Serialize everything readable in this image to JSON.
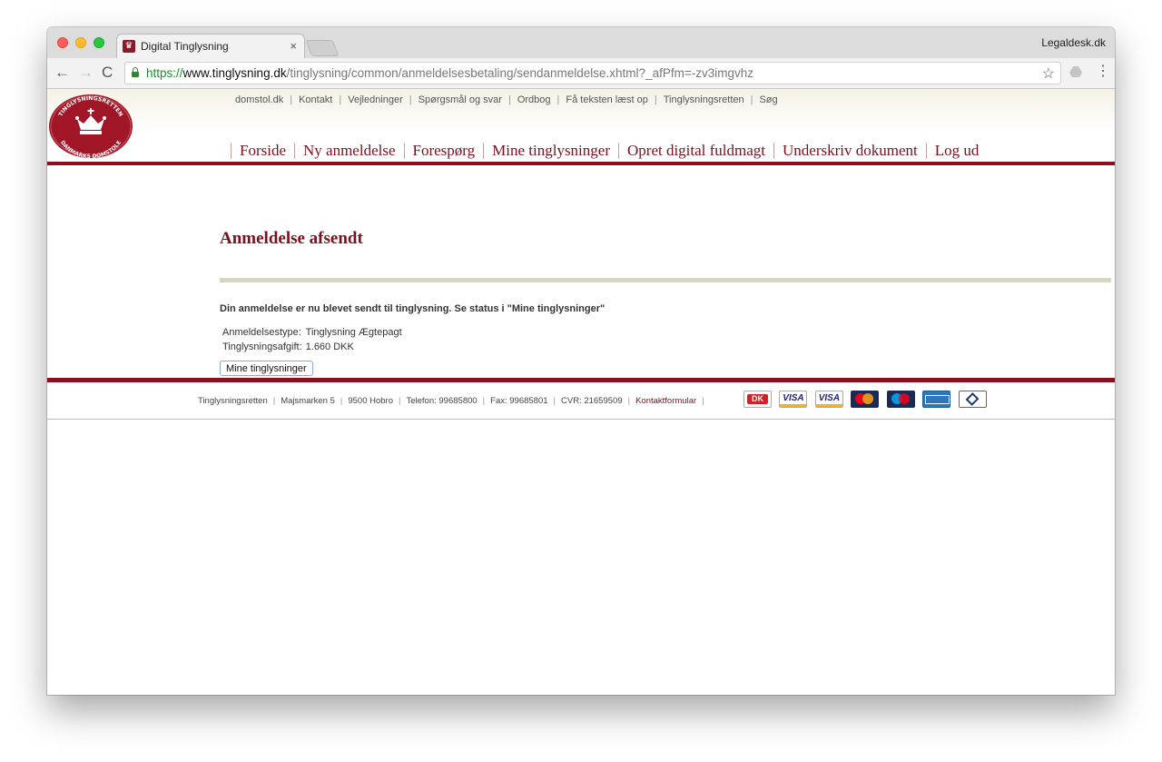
{
  "browser": {
    "tab_title": "Digital Tinglysning",
    "tab_close": "×",
    "profile_name": "Legaldesk.dk",
    "url_scheme": "https://",
    "url_host": "www.tinglysning.dk",
    "url_path": "/tinglysning/common/anmeldelsesbetaling/sendanmeldelse.xhtml?_afPfm=-zv3imgvhz",
    "back_icon": "←",
    "forward_icon": "→",
    "reload_icon": "C",
    "star_icon": "☆",
    "menu_icon": "⋮"
  },
  "logo": {
    "top_text": "TINGLYSNINGSRETTEN",
    "bottom_text": "DANMARKS DOMSTOLE"
  },
  "top_links": [
    "domstol.dk",
    "Kontakt",
    "Vejledninger",
    "Spørgsmål og svar",
    "Ordbog",
    "Få teksten læst op",
    "Tinglysningsretten",
    "Søg"
  ],
  "main_nav": [
    "Forside",
    "Ny anmeldelse",
    "Forespørg",
    "Mine tinglysninger",
    "Opret digital fuldmagt",
    "Underskriv dokument",
    "Log ud"
  ],
  "content": {
    "title": "Anmeldelse afsendt",
    "message": "Din anmeldelse er nu blevet sendt til tinglysning. Se status i \"Mine tinglysninger\"",
    "details": [
      {
        "label": "Anmeldelsestype:",
        "value": "Tinglysning Ægtepagt"
      },
      {
        "label": "Tinglysningsafgift:",
        "value": "1.660 DKK"
      }
    ],
    "button_label": "Mine tinglysninger"
  },
  "footer": {
    "items": [
      "Tinglysningsretten",
      "Majsmarken 5",
      "9500 Hobro",
      "Telefon: 99685800",
      "Fax: 99685801",
      "CVR: 21659509"
    ],
    "contact_link": "Kontaktformular",
    "cards": {
      "dk": "DK",
      "visa": "VISA",
      "visa_electron": "VISA"
    }
  },
  "colors": {
    "brand_red": "#8a1020",
    "title_red": "#7a1020",
    "rule_beige": "#d8d4c4"
  }
}
